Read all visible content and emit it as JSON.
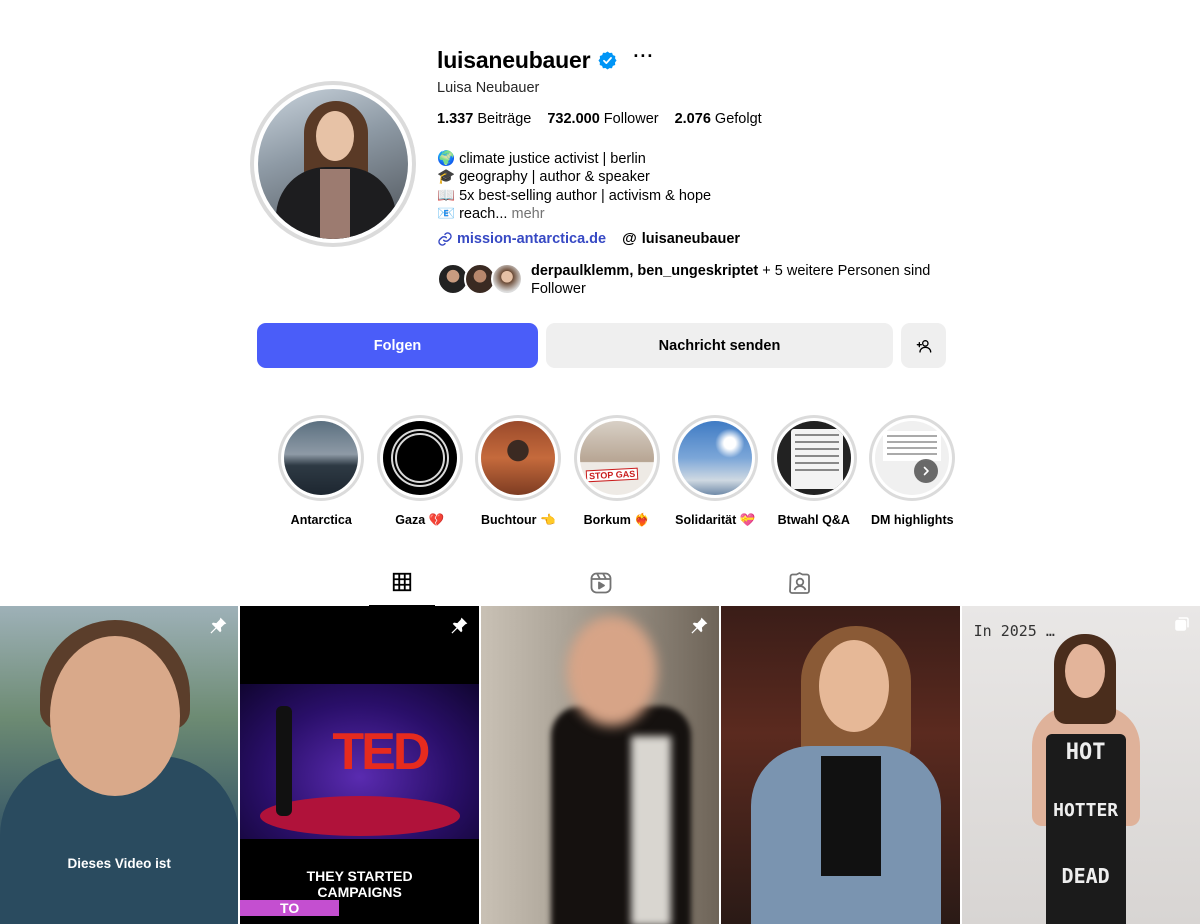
{
  "profile": {
    "username": "luisaneubauer",
    "more_label": "···",
    "full_name": "Luisa Neubauer",
    "stats": {
      "posts_count": "1.337",
      "posts_label": "Beiträge",
      "followers_count": "732.000",
      "followers_label": "Follower",
      "following_count": "2.076",
      "following_label": "Gefolgt"
    },
    "bio": {
      "line1": "🌍 climate justice activist | berlin",
      "line2": "🎓 geography | author & speaker",
      "line3": "📖 5x best-selling author | activism & hope",
      "line4": "📧 reach...",
      "more": "mehr"
    },
    "link": "mission-antarctica.de",
    "threads_handle": "luisaneubauer",
    "followed_by": {
      "names": "derpaulklemm, ben_ungeskriptet",
      "rest": " + 5 weitere Personen sind Follower"
    }
  },
  "actions": {
    "follow": "Folgen",
    "message": "Nachricht senden"
  },
  "highlights": [
    {
      "label": "Antarctica"
    },
    {
      "label": "Gaza 💔"
    },
    {
      "label": "Buchtour 👈"
    },
    {
      "label": "Borkum ❤️‍🔥"
    },
    {
      "label": "Solidarität 💝"
    },
    {
      "label": "Btwahl Q&A"
    },
    {
      "label": "DM highlights"
    }
  ],
  "highlight_texts": {
    "stop_gas": "STOP GAS"
  },
  "tabs": {
    "icons": [
      "grid-icon",
      "reels-icon",
      "tagged-icon"
    ],
    "active": "posts"
  },
  "posts": [
    {
      "overlay": "Dieses Video ist",
      "pinned": true
    },
    {
      "overlay_line1": "THEY STARTED",
      "overlay_line2a": "CAMPAIGNS ",
      "overlay_line2b": "TO",
      "stage_text": "TED",
      "pinned": true
    },
    {
      "pinned": true
    },
    {
      "pinned": false
    },
    {
      "overlay_top": "In 2025 …",
      "dress1": "HOT",
      "dress2": "HOTTER",
      "dress3": "DEAD",
      "multi": true
    }
  ],
  "colors": {
    "accent": "#4a5df9",
    "link": "#3749c4",
    "verified": "#0095f6"
  }
}
